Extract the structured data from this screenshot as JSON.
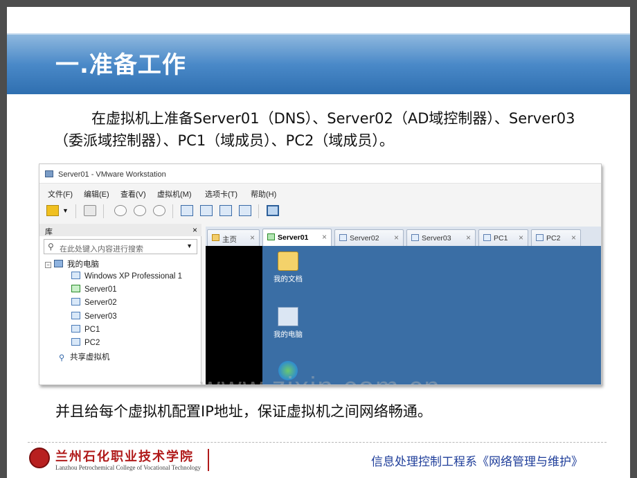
{
  "slide": {
    "title": "一.准备工作",
    "intro_paragraph": "在虚拟机上准备Server01（DNS）、Server02（AD域控制器）、Server03（委派域控制器）、PC1（域成员）、PC2（域成员）。",
    "note": "并且给每个虚拟机配置IP地址，保证虚拟机之间网络畅通。",
    "watermark": "www.zixin.com.cn"
  },
  "vmware": {
    "window_title": "Server01 - VMware Workstation",
    "menu": [
      "文件(F)",
      "编辑(E)",
      "查看(V)",
      "虚拟机(M)",
      "选项卡(T)",
      "帮助(H)"
    ],
    "library": {
      "header": "库",
      "close": "×",
      "search_placeholder": "在此处键入内容进行搜索",
      "tree": {
        "root": "我的电脑",
        "items": [
          "Windows XP Professional 1",
          "Server01",
          "Server02",
          "Server03",
          "PC1",
          "PC2"
        ],
        "shared": "共享虚拟机"
      }
    },
    "tabs": [
      {
        "label": "主页",
        "close": "×"
      },
      {
        "label": "Server01",
        "close": "×"
      },
      {
        "label": "Server02",
        "close": "×"
      },
      {
        "label": "Server03",
        "close": "×"
      },
      {
        "label": "PC1",
        "close": "×"
      },
      {
        "label": "PC2",
        "close": "×"
      }
    ],
    "desktop_icons": [
      "我的文档",
      "我的电脑"
    ]
  },
  "footer": {
    "school_cn": "兰州石化职业技术学院",
    "school_en": "Lanzhou Petrochemical College of Vocational Technology",
    "department": "信息处理控制工程系《网络管理与维护》"
  },
  "colors": {
    "title_band": "#4a89c8",
    "frame": "#4d4d4d",
    "vm_desktop": "#3a6ea5",
    "footer_text": "#1f3e9a",
    "school_red": "#b01a1a"
  }
}
